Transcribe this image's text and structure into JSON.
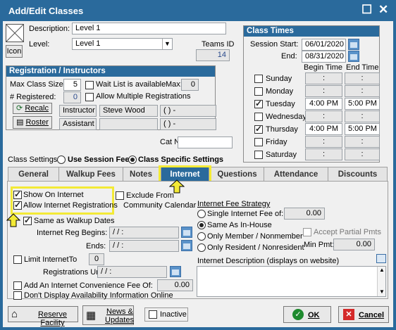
{
  "window": {
    "title": "Add/Edit Classes"
  },
  "top": {
    "icon_label": "Icon",
    "description_label": "Description:",
    "description_value": "Level 1",
    "level_label": "Level:",
    "level_value": "Level 1",
    "teams_id_label": "Teams ID",
    "teams_id_value": "14"
  },
  "registration": {
    "header": "Registration / Instructors",
    "max_class_size_label": "Max Class Size:",
    "max_class_size_value": "5",
    "registered_label": "# Registered:",
    "registered_value": "0",
    "wait_list_label": "Wait List is available",
    "max_label": "Max:",
    "max_value": "0",
    "allow_multiple_label": "Allow Multiple Registrations",
    "recalc_label": "Recalc",
    "roster_label": "Roster",
    "instructor_label": "Instructor",
    "instructor_value": "Steve Wood",
    "instructor_phone": "(   )   -",
    "assistant_label": "Assistant",
    "assistant_phone": "(   )   -"
  },
  "class_times": {
    "header": "Class Times",
    "session_start_label": "Session Start:",
    "session_start_value": "06/01/2020",
    "end_label": "End:",
    "end_value": "08/31/2020",
    "begin_time_label": "Begin Time",
    "end_time_label": "End Time",
    "days": [
      {
        "name": "Sunday",
        "checked": false,
        "begin": ":",
        "end": ":"
      },
      {
        "name": "Monday",
        "checked": false,
        "begin": ":",
        "end": ":"
      },
      {
        "name": "Tuesday",
        "checked": true,
        "begin": "4:00 PM",
        "end": "5:00 PM"
      },
      {
        "name": "Wednesday",
        "checked": false,
        "begin": ":",
        "end": ":"
      },
      {
        "name": "Thursday",
        "checked": true,
        "begin": "4:00 PM",
        "end": "5:00 PM"
      },
      {
        "name": "Friday",
        "checked": false,
        "begin": ":",
        "end": ":"
      },
      {
        "name": "Saturday",
        "checked": false,
        "begin": ":",
        "end": ":"
      }
    ]
  },
  "cat_no_label": "Cat No",
  "class_settings": {
    "label": "Class Settings:",
    "use_session_fees": "Use Session Fees",
    "class_specific": "Class Specific Settings"
  },
  "tabs": [
    "General",
    "Walkup Fees",
    "Notes",
    "Internet",
    "Questions",
    "Attendance",
    "Discounts"
  ],
  "internet": {
    "show_on_internet": "Show On Internet",
    "allow_internet_registrations": "Allow Internet Registrations",
    "exclude_from": "Exclude From",
    "community_calendar": "Community Calendar",
    "same_as_walkup": "Same as Walkup Dates",
    "reg_begins_label": "Internet Reg Begins:",
    "reg_begins_value": " /  /        :",
    "ends_label": "Ends:",
    "ends_value": " /  /        :",
    "limit_internet_to": "Limit InternetTo",
    "limit_value": "0",
    "registrations_until": "Registrations Until:",
    "registrations_until_value": " /  /        :",
    "convenience_fee_label": "Add An Internet Convenience Fee Of:",
    "convenience_fee_value": "0.00",
    "dont_display": "Don't Display Availability Information Online",
    "fee_strategy_header": "Internet Fee Strategy",
    "single_fee_label": "Single Internet Fee of:",
    "single_fee_value": "0.00",
    "same_as_inhouse": "Same As In-House",
    "only_member": "Only Member / Nonmember",
    "only_resident": "Only Resident / Nonresident",
    "accept_partial": "Accept Partial Pmts",
    "min_pmt_label": "Min Pmt:",
    "min_pmt_value": "0.00",
    "description_label": "Internet Description  (displays on website)"
  },
  "footer": {
    "reserve_facility": "Reserve Facility",
    "news_updates_1": "News &",
    "news_updates_2": "Updates",
    "inactive": "Inactive",
    "ok": "OK",
    "cancel": "Cancel"
  }
}
